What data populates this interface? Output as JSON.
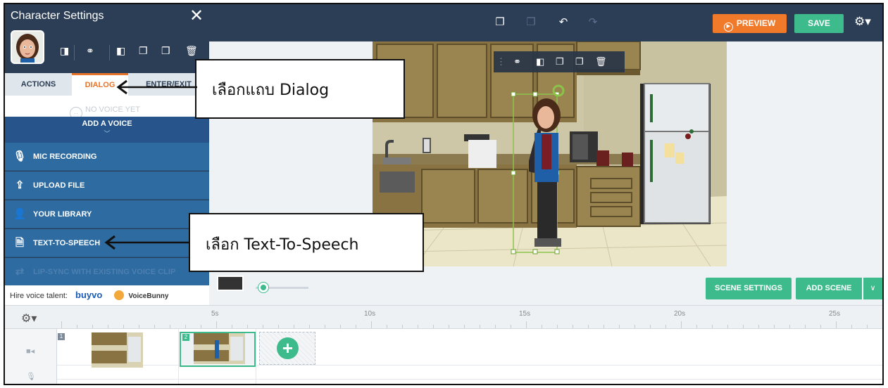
{
  "panel": {
    "title": "Character Settings",
    "close_glyph": "✕",
    "tabs": [
      "ACTIONS",
      "DIALOG",
      "ENTER/EXIT"
    ],
    "no_voice_text": "NO VOICE YET",
    "add_voice_label": "ADD A VOICE",
    "options": [
      "MIC RECORDING",
      "UPLOAD FILE",
      "YOUR LIBRARY",
      "TEXT-TO-SPEECH",
      "LIP-SYNC WITH EXISTING VOICE CLIP"
    ],
    "hire_label": "Hire voice talent:",
    "hire_brands": [
      "buyvo",
      "VoiceBunny"
    ]
  },
  "toolbar": {
    "preview_label": "PREVIEW",
    "save_label": "SAVE"
  },
  "stage_controls": {
    "scene_settings_label": "SCENE SETTINGS",
    "add_scene_label": "ADD SCENE",
    "zoom_level": 0.1
  },
  "timeline": {
    "ticks": [
      "5s",
      "10s",
      "15s",
      "20s",
      "25s"
    ],
    "scenes": [
      "1",
      "2"
    ]
  },
  "annotations": {
    "dialog_note": "เลือกแถบ Dialog",
    "tts_note": "เลือก Text-To-Speech"
  },
  "colors": {
    "accent_orange": "#f07a2a",
    "accent_green": "#3dbb8c",
    "topbar": "#2c3e55",
    "option_blue": "#2d6ba1"
  }
}
